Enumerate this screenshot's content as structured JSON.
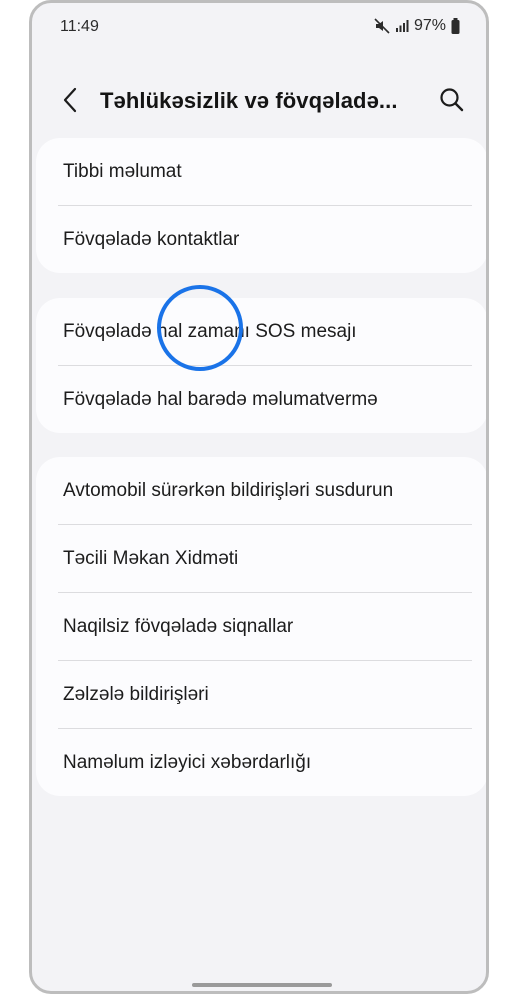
{
  "status_bar": {
    "time": "11:49",
    "battery": "97%"
  },
  "header": {
    "title": "Təhlükəsizlik və fövqəladə..."
  },
  "cards": [
    {
      "items": [
        {
          "label": "Tibbi məlumat"
        },
        {
          "label": "Fövqəladə kontaktlar"
        }
      ]
    },
    {
      "items": [
        {
          "label": "Fövqəladə hal zamanı SOS mesajı"
        },
        {
          "label": "Fövqəladə hal barədə məlumatvermə"
        }
      ]
    },
    {
      "items": [
        {
          "label": "Avtomobil sürərkən bildirişləri susdurun"
        },
        {
          "label": "Təcili Məkan Xidməti"
        },
        {
          "label": "Naqilsiz fövqəladə siqnallar"
        },
        {
          "label": "Zəlzələ bildirişləri"
        },
        {
          "label": "Naməlum izləyici xəbərdarlığı"
        }
      ]
    }
  ],
  "icons": {
    "back": "chevron-left-icon",
    "search": "search-icon",
    "mute": "mute-icon",
    "signal": "signal-icon",
    "battery": "battery-icon"
  },
  "colors": {
    "accent": "#1a73e8",
    "background": "#f3f3f6",
    "card": "#fcfcfe"
  }
}
